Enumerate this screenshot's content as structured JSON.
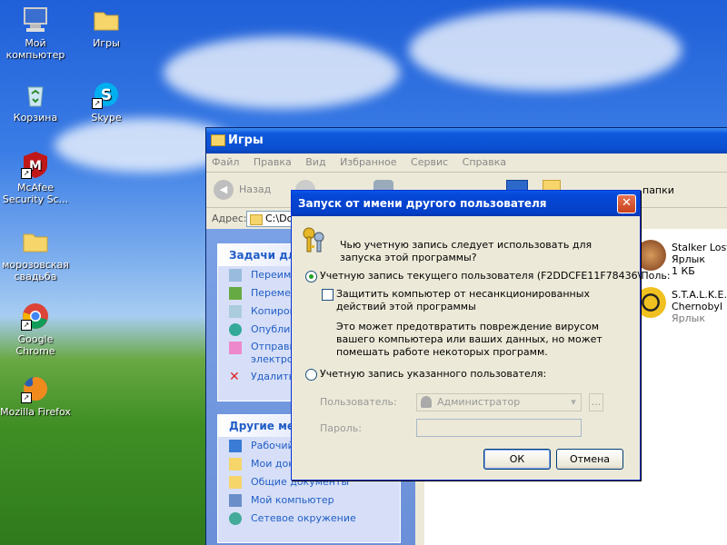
{
  "desktop": {
    "icons": [
      {
        "label": "Мой компьютер",
        "icon": "my-computer-icon"
      },
      {
        "label": "Игры",
        "icon": "folder-icon"
      },
      {
        "label": "Корзина",
        "icon": "recycle-bin-icon"
      },
      {
        "label": "Skype",
        "icon": "skype-icon"
      },
      {
        "label": "McAfee Security Sc...",
        "icon": "mcafee-icon"
      },
      {
        "label": "морозовская свадьба",
        "icon": "folder-icon"
      },
      {
        "label": "Google Chrome",
        "icon": "chrome-icon"
      },
      {
        "label": "Mozilla Firefox",
        "icon": "firefox-icon"
      }
    ]
  },
  "explorer": {
    "title": "Игры",
    "menu": [
      "Файл",
      "Правка",
      "Вид",
      "Избранное",
      "Сервис",
      "Справка"
    ],
    "back_label": "Назад",
    "address_label": "Адрес:",
    "address_value": "C:\\Do",
    "toolbar_partial": "папки",
    "tasks_title": "Задачи для",
    "tasks": [
      "Переиме",
      "Перемест",
      "Копиров",
      "Опублик",
      "Отправи",
      "Удалить"
    ],
    "tasks_line2": "электрон",
    "places_title": "Другие мес",
    "places": [
      "Рабочий",
      "Мои доку",
      "Общие документы",
      "Мой компьютер",
      "Сетевое окружение"
    ],
    "files": [
      {
        "name": "Stalker Lost",
        "type": "Ярлык",
        "size": "1 КБ"
      },
      {
        "name": "S.T.A.L.K.E.",
        "sub": "Chernobyl",
        "type": "Ярлык"
      }
    ]
  },
  "dialog": {
    "title": "Запуск от имени другого пользователя",
    "prompt": "Чью учетную запись следует использовать для запуска этой программы?",
    "option_current": "Учетную запись текущего пользователя (F2DDCFE11F78436\\Поль:",
    "protect_label": "Защитить компьютер от несанкционированных действий этой программы",
    "protect_note": "Это может предотвратить повреждение вирусом вашего компьютера или ваших данных, но может помешать работе некоторых программ.",
    "option_other": "Учетную запись указанного пользователя:",
    "user_label": "Пользователь:",
    "user_value": "Администратор",
    "password_label": "Пароль:",
    "browse_label": "...",
    "ok_label": "ОК",
    "cancel_label": "Отмена",
    "selected_option": "current",
    "protect_checked": false
  }
}
